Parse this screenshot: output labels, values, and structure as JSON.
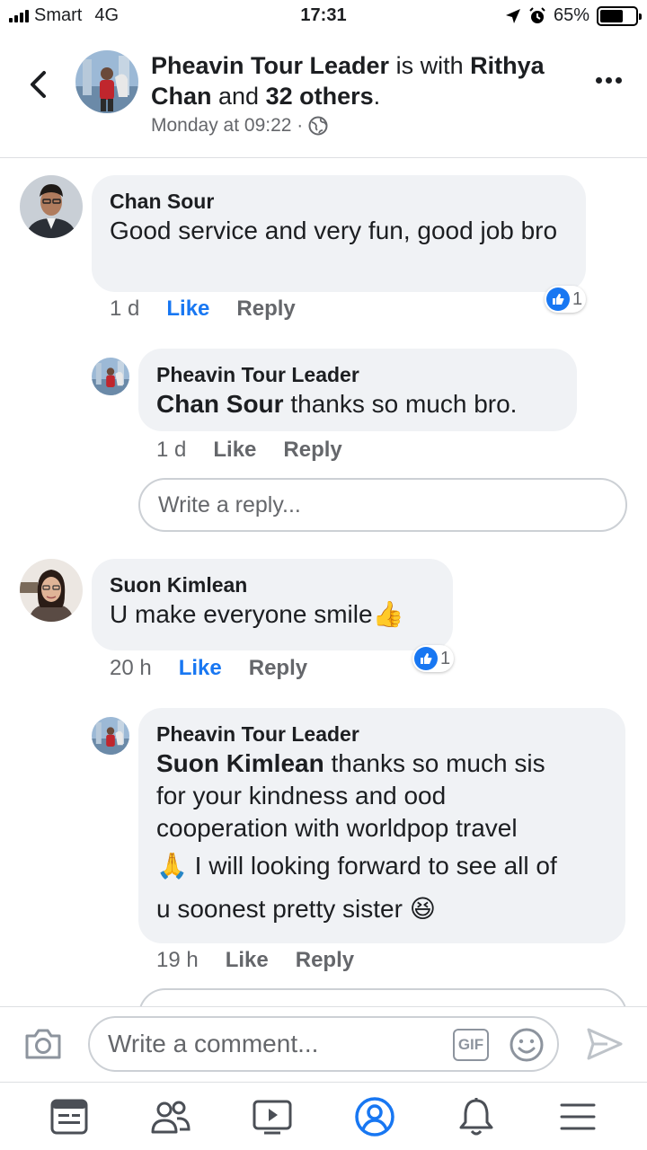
{
  "status_bar": {
    "carrier": "Smart",
    "network": "4G",
    "time": "17:31",
    "battery": "65%",
    "battery_level": 0.65
  },
  "header": {
    "author": "Pheavin Tour Leader",
    "with_text": "is with",
    "tagged": "Rithya Chan",
    "and_text": "and",
    "others": "32 others",
    "period": ".",
    "timestamp": "Monday at 09:22 ·"
  },
  "comments": [
    {
      "author": "Chan Sour",
      "text": "Good service and very fun, good job bro",
      "time": "1 d",
      "like_label": "Like",
      "reply_label": "Reply",
      "reactions": "1",
      "liked": true
    },
    {
      "author": "Suon Kimlean",
      "text": "U make everyone smile",
      "emoji": "👍",
      "time": "20 h",
      "like_label": "Like",
      "reply_label": "Reply",
      "reactions": "1",
      "liked": true
    }
  ],
  "replies": [
    {
      "author": "Pheavin Tour Leader",
      "mention": "Chan Sour",
      "text": " thanks so much bro.",
      "time": "1 d",
      "like_label": "Like",
      "reply_label": "Reply"
    },
    {
      "author": "Pheavin Tour Leader",
      "mention": "Suon Kimlean",
      "text_line1": " thanks so much sis",
      "text_line2": "for your kindness and ood",
      "text_line3": "cooperation with worldpop travel",
      "emoji_pray": "🙏",
      "text_line4": " I will looking forward to see all of",
      "text_line5": "u soonest pretty sister ",
      "emoji_laugh": "😆",
      "time": "19 h",
      "like_label": "Like",
      "reply_label": "Reply"
    }
  ],
  "reply_input": {
    "placeholder": "Write a reply..."
  },
  "composer": {
    "placeholder": "Write a comment...",
    "gif_label": "GIF"
  },
  "colors": {
    "accent": "#1877f2",
    "bubble": "#f0f2f5",
    "muted": "#65676b"
  }
}
